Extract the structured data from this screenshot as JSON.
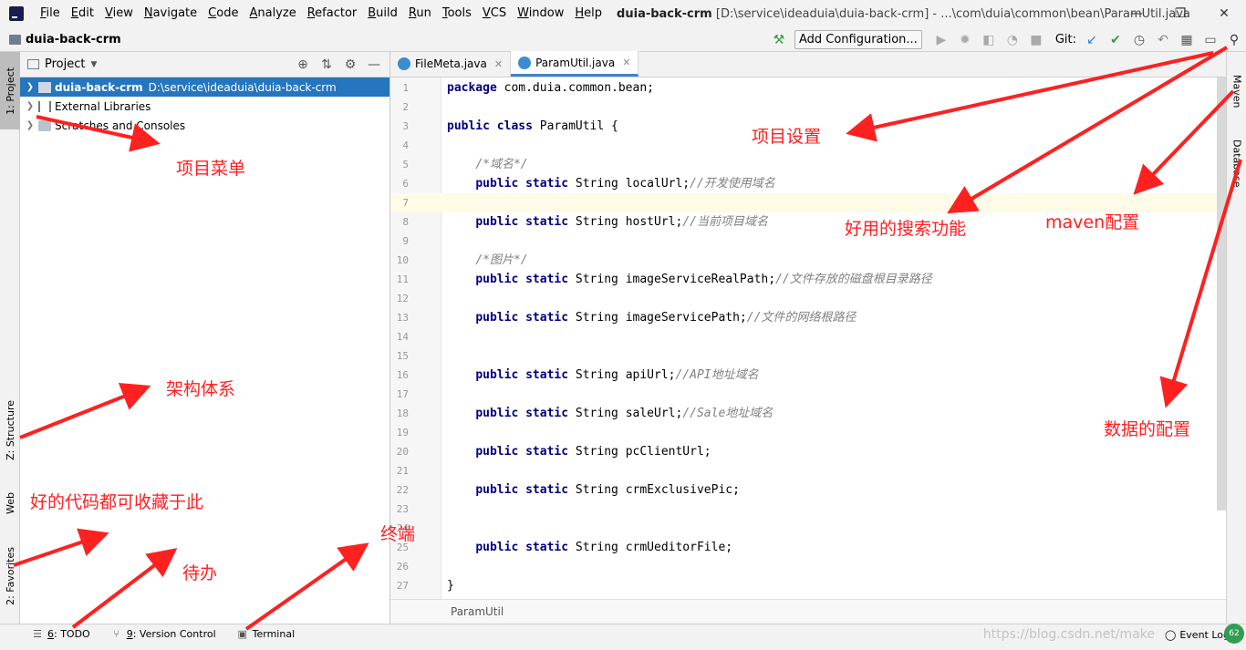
{
  "menubar": {
    "items": [
      "File",
      "Edit",
      "View",
      "Navigate",
      "Code",
      "Analyze",
      "Refactor",
      "Build",
      "Run",
      "Tools",
      "VCS",
      "Window",
      "Help"
    ],
    "title_project": "duia-back-crm",
    "title_path": "[D:\\service\\ideaduia\\duia-back-crm] - ...\\com\\duia\\common\\bean\\ParamUtil.java",
    "minimize": "—",
    "restore": "❐",
    "close": "✕"
  },
  "navbar": {
    "crumb": "duia-back-crm",
    "add_config": "Add Configuration...",
    "git_label": "Git:"
  },
  "left_stripe": {
    "project": "1: Project",
    "structure": "Z: Structure",
    "web": "Web",
    "favorites": "2: Favorites"
  },
  "right_stripe": {
    "maven": "Maven",
    "database": "Database"
  },
  "project_panel": {
    "title": "Project",
    "rows": [
      {
        "name": "duia-back-crm",
        "path": "D:\\service\\ideaduia\\duia-back-crm"
      },
      {
        "name": "External Libraries",
        "path": ""
      },
      {
        "name": "Scratches and Consoles",
        "path": ""
      }
    ]
  },
  "editor": {
    "tabs": [
      {
        "label": "FileMeta.java"
      },
      {
        "label": "ParamUtil.java"
      }
    ],
    "lines": [
      {
        "n": "1",
        "text": "package com.duia.common.bean;"
      },
      {
        "n": "2",
        "text": ""
      },
      {
        "n": "3",
        "text": "public class ParamUtil {"
      },
      {
        "n": "4",
        "text": ""
      },
      {
        "n": "5",
        "text": "    /*域名*/"
      },
      {
        "n": "6",
        "text": "    public static String localUrl;//开发使用域名"
      },
      {
        "n": "7",
        "text": ""
      },
      {
        "n": "8",
        "text": "    public static String hostUrl;//当前项目域名"
      },
      {
        "n": "9",
        "text": ""
      },
      {
        "n": "10",
        "text": "    /*图片*/"
      },
      {
        "n": "11",
        "text": "    public static String imageServiceRealPath;//文件存放的磁盘根目录路径"
      },
      {
        "n": "12",
        "text": ""
      },
      {
        "n": "13",
        "text": "    public static String imageServicePath;//文件的网络根路径"
      },
      {
        "n": "14",
        "text": ""
      },
      {
        "n": "15",
        "text": ""
      },
      {
        "n": "16",
        "text": "    public static String apiUrl;//API地址域名"
      },
      {
        "n": "17",
        "text": ""
      },
      {
        "n": "18",
        "text": "    public static String saleUrl;//Sale地址域名"
      },
      {
        "n": "19",
        "text": ""
      },
      {
        "n": "20",
        "text": "    public static String pcClientUrl;"
      },
      {
        "n": "21",
        "text": ""
      },
      {
        "n": "22",
        "text": "    public static String crmExclusivePic;"
      },
      {
        "n": "23",
        "text": ""
      },
      {
        "n": "24",
        "text": ""
      },
      {
        "n": "25",
        "text": "    public static String crmUeditorFile;"
      },
      {
        "n": "26",
        "text": ""
      },
      {
        "n": "27",
        "text": "}"
      }
    ],
    "current_line": "7",
    "breadcrumb": "ParamUtil"
  },
  "bottombar": {
    "todo_num": "6",
    "todo_label": ": TODO",
    "vc_num": "9",
    "vc_label": ": Version Control",
    "terminal": "Terminal",
    "event_log": "Event Log",
    "watermark": "https://blog.csdn.net/make",
    "badge": "62"
  },
  "annotations": {
    "project_menu": "项目菜单",
    "project_settings": "项目设置",
    "search": "好用的搜索功能",
    "maven": "maven配置",
    "database": "数据的配置",
    "structure": "架构体系",
    "favorites": "好的代码都可收藏于此",
    "terminal": "终端",
    "todo": "待办"
  },
  "colors": {
    "selection": "#2675bf",
    "annotation": "#ff2020",
    "keyword": "#000080",
    "comment": "#808080"
  }
}
